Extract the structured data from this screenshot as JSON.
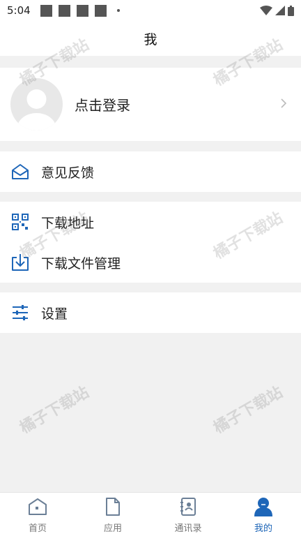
{
  "status_bar": {
    "time": "5:04"
  },
  "app_bar": {
    "title": "我"
  },
  "profile": {
    "login_label": "点击登录"
  },
  "menu": {
    "feedback": "意见反馈",
    "download_address": "下载地址",
    "download_manage": "下载文件管理",
    "settings": "设置"
  },
  "watermark": "橘子下载站",
  "bottom_nav": {
    "items": [
      {
        "label": "首页",
        "icon": "home-icon"
      },
      {
        "label": "应用",
        "icon": "file-icon"
      },
      {
        "label": "通讯录",
        "icon": "contacts-icon"
      },
      {
        "label": "我的",
        "icon": "user-icon"
      }
    ],
    "active_index": 3
  },
  "colors": {
    "accent": "#1e66b8",
    "background": "#f1f1f1",
    "text": "#222222"
  }
}
